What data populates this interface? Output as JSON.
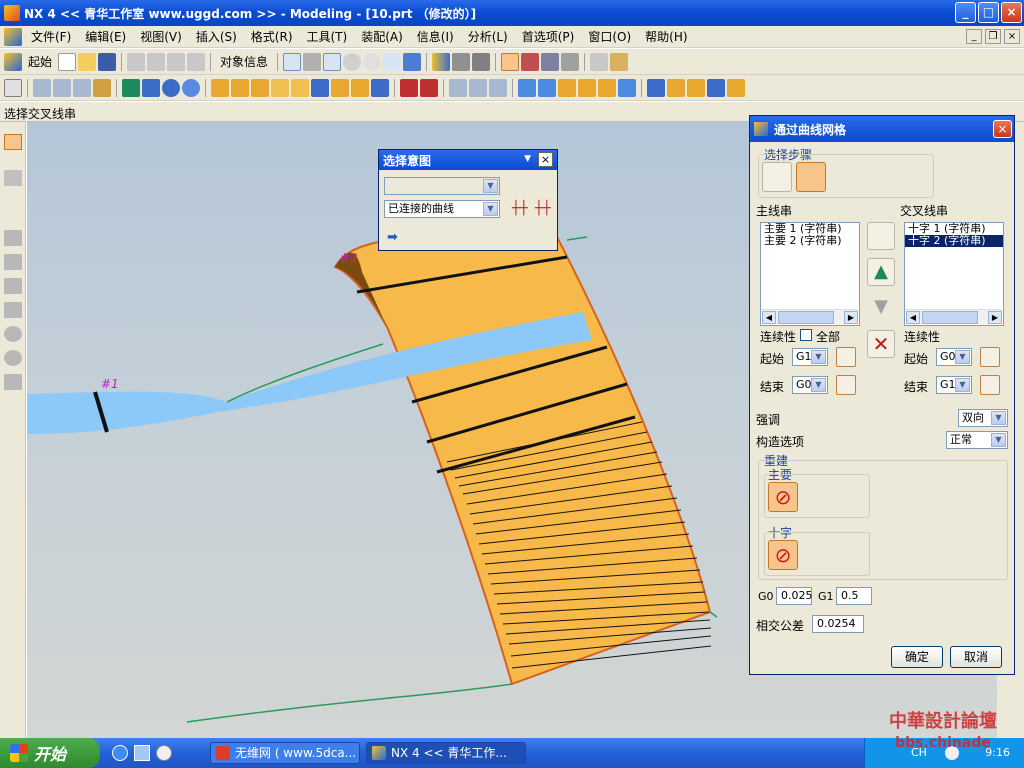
{
  "window": {
    "title": "NX 4 << 青华工作室 www.uggd.com >> - Modeling - [10.prt （修改的）]",
    "controls": [
      "_",
      "□",
      "×"
    ]
  },
  "menubar": {
    "items": [
      "文件(F)",
      "编辑(E)",
      "视图(V)",
      "插入(S)",
      "格式(R)",
      "工具(T)",
      "装配(A)",
      "信息(I)",
      "分析(L)",
      "首选项(P)",
      "窗口(O)",
      "帮助(H)"
    ]
  },
  "toolbar1": {
    "start_label": "起始",
    "object_info_label": "对象信息"
  },
  "status": {
    "prompt": "选择交叉线串"
  },
  "viewport": {
    "marker1": "#1",
    "marker2": "#2"
  },
  "select_intent": {
    "title": "选择意图",
    "curve_rule": "已连接的曲线"
  },
  "dialog": {
    "title": "通过曲线网格",
    "steps_label": "选择步骤",
    "primary_label": "主线串",
    "cross_label": "交叉线串",
    "primary_items": [
      "主要 1 (字符串)",
      "主要 2 (字符串)"
    ],
    "cross_items": [
      "十字 1 (字符串)",
      "十字 2 (字符串)"
    ],
    "continuity_label": "连续性",
    "all_label": "全部",
    "start_label": "起始",
    "end_label": "结束",
    "primary_start": "G1",
    "primary_end": "G0",
    "cross_start": "G0",
    "cross_end": "G1",
    "emphasis_label": "强调",
    "emphasis_value": "双向",
    "construction_label": "构造选项",
    "construction_value": "正常",
    "rebuild_label": "重建",
    "primary_group": "主要",
    "cross_group": "十字",
    "g0_label": "G0",
    "g0_value": "0.025",
    "g1_label": "G1",
    "g1_value": "0.5",
    "tolerance_label": "相交公差",
    "tolerance_value": "0.0254",
    "ok": "确定",
    "cancel": "取消"
  },
  "taskbar": {
    "start": "开始",
    "tasks": [
      "无维网 ( www.5dca...",
      "NX 4 << 青华工作..."
    ],
    "tray_text": "CH",
    "clock": "9:16"
  },
  "watermark": {
    "line1": "中華設計論壇",
    "line2": "bbs.chinade"
  },
  "colors": {
    "surface": "#f6b94a",
    "ribbon": "#8cc8f8",
    "titlebar": "#0a4cd0"
  }
}
